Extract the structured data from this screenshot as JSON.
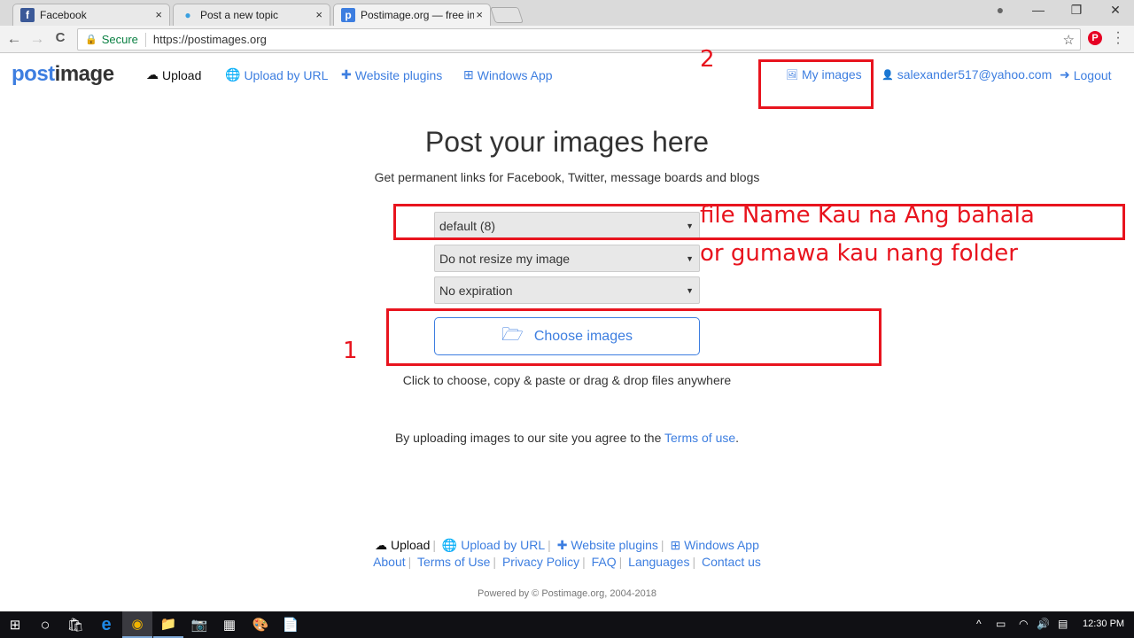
{
  "browser": {
    "tabs": [
      {
        "title": "Facebook",
        "icon": "facebook-icon",
        "icon_color": "#3b5998",
        "icon_glyph": "f"
      },
      {
        "title": "Post a new topic",
        "icon": "chat-bubble-icon",
        "icon_color": "#3aa0e0",
        "icon_glyph": "💬"
      },
      {
        "title": "Postimage.org — free ima",
        "icon": "postimage-icon",
        "icon_color": "#3d7ee0",
        "icon_glyph": "p",
        "active": true
      }
    ],
    "tab_close": "×",
    "window_controls": {
      "profile": "●",
      "minimize": "—",
      "restore": "❐",
      "close": "✕"
    },
    "nav": {
      "back": "←",
      "forward": "→",
      "reload": "C"
    },
    "omnibox": {
      "secure_label": "Secure",
      "url": "https://postimages.org",
      "star": "☆"
    },
    "extensions": {
      "pinterest": "P",
      "menu": "⋮"
    }
  },
  "site": {
    "logo": {
      "part1": "post",
      "part2": "image"
    },
    "nav": [
      {
        "label": "Upload",
        "icon": "cloud-upload-icon",
        "glyph": "☁"
      },
      {
        "label": "Upload by URL",
        "icon": "globe-icon",
        "glyph": "🌐"
      },
      {
        "label": "Website plugins",
        "icon": "puzzle-icon",
        "glyph": "✚"
      },
      {
        "label": "Windows App",
        "icon": "windows-icon",
        "glyph": "⊞"
      }
    ],
    "user_nav": [
      {
        "label": "My images",
        "icon": "image-icon",
        "glyph": "🖼"
      },
      {
        "label": "salexander517@yahoo.com",
        "icon": "user-icon",
        "glyph": "👤"
      },
      {
        "label": "Logout",
        "icon": "logout-icon",
        "glyph": "➜"
      }
    ],
    "brand_color": "#3d7ee0"
  },
  "main": {
    "title": "Post your images here",
    "subtitle": "Get permanent links for Facebook, Twitter, message boards and blogs",
    "selects": {
      "gallery": "default (8)",
      "resize": "Do not resize my image",
      "expiration": "No expiration"
    },
    "choose_button": "Choose images",
    "hint": "Click to choose, copy & paste or drag & drop files anywhere",
    "terms_prefix": "By uploading images to our site you agree to the ",
    "terms_link": "Terms of use",
    "terms_suffix": "."
  },
  "annotations": {
    "step1": "1",
    "step2": "2",
    "note_line1": "file Name Kau na Ang bahala",
    "note_line2": "or gumawa kau nang folder",
    "color": "#e8141e"
  },
  "footer": {
    "row1": [
      {
        "label": "Upload",
        "glyph": "☁"
      },
      {
        "label": "Upload by URL",
        "glyph": "🌐"
      },
      {
        "label": "Website plugins",
        "glyph": "✚"
      },
      {
        "label": "Windows App",
        "glyph": "⊞"
      }
    ],
    "row2": [
      "About",
      "Terms of Use",
      "Privacy Policy",
      "FAQ",
      "Languages",
      "Contact us"
    ],
    "separator": "|",
    "powered": "Powered by © Postimage.org, 2004-2018"
  },
  "taskbar": {
    "items": [
      "start",
      "cortana",
      "store",
      "edge",
      "chrome",
      "file-explorer",
      "camera",
      "calculator",
      "paint",
      "notepad"
    ],
    "glyphs": [
      "⊞",
      "○",
      "🛍",
      "e",
      "◉",
      "📁",
      "📷",
      "▦",
      "🎨",
      "📄"
    ],
    "tray": {
      "chevron": "^",
      "battery": "▭",
      "wifi": "◠",
      "volume": "🔊",
      "notifications": "▤"
    },
    "clock": "12:30 PM"
  }
}
